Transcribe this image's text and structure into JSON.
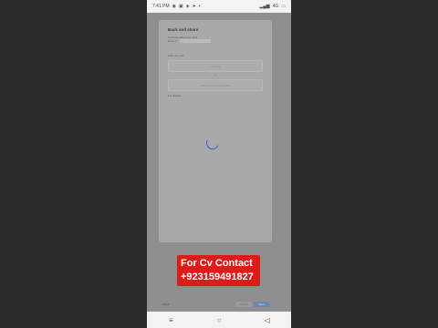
{
  "statusbar": {
    "time": "7:41 PM",
    "left_icons": [
      "whatsapp-icon",
      "gallery-icon",
      "cast-icon",
      "send-icon",
      "dot-icon"
    ],
    "right_text": "4G"
  },
  "dialog": {
    "title": "Back and share",
    "line1": "Upload a document and",
    "line2": "share it",
    "section_label": "Add your CV",
    "field1_placeholder": "Upload",
    "or_text": "or",
    "field2_placeholder": "Paste a link or drop a file",
    "footnote": "For details"
  },
  "overlay": {
    "line1": "For Cv Contact",
    "line2": "+923159491827"
  },
  "footer": {
    "left_label": "< Back",
    "cancel_label": "Cancel",
    "save_label": "Next"
  },
  "navbar": {
    "menu_icon": "≡",
    "home_icon": "○",
    "back_icon": "◁"
  }
}
